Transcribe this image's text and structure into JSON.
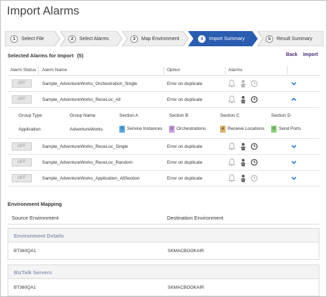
{
  "page": {
    "title": "Import Alarms"
  },
  "wizard": {
    "steps": [
      {
        "num": "1",
        "label": "Select File"
      },
      {
        "num": "2",
        "label": "Select Alarms"
      },
      {
        "num": "3",
        "label": "Map Environment"
      },
      {
        "num": "4",
        "label": "Import Summary",
        "active": true
      },
      {
        "num": "5",
        "label": "Result Summary"
      }
    ],
    "active_color": "#2a5db0"
  },
  "selected": {
    "title": "Selected Alarms for Import",
    "count": "(5)",
    "back_label": "Back",
    "import_label": "Import"
  },
  "table": {
    "headers": {
      "status": "Alarm Status",
      "name": "Alarm Name",
      "option": "Option",
      "alarms": "Alarms"
    },
    "rows": [
      {
        "toggle": "OFF",
        "name": "Sample_AdventureWorks_Orchestration_Single",
        "option": "Error on duplicate",
        "expanded": false
      },
      {
        "toggle": "OFF",
        "name": "Sample_AdventureWorks_ReceLoc_All",
        "option": "Error on duplicate",
        "expanded": true
      },
      {
        "toggle": "OFF",
        "name": "Sample_AdventureWorks_ReceLoc_Single",
        "option": "Error on duplicate",
        "expanded": false
      },
      {
        "toggle": "OFF",
        "name": "Sample_AdventureWorks_ReceLoc_Random",
        "option": "Error on duplicate",
        "expanded": false
      },
      {
        "toggle": "OFF",
        "name": "Sample_AdventureWorks_Application_AllSection",
        "option": "Error on duplicate",
        "expanded": false
      }
    ],
    "detail": {
      "headers": {
        "group_type": "Group Type",
        "group_name": "Group Name",
        "a": "Section A",
        "b": "Section B",
        "c": "Section C",
        "d": "Section D"
      },
      "values": {
        "group_type": "Application",
        "group_name": "AdventureWorks",
        "a_count": "0",
        "a_label": "Service Instances",
        "a_color": "#5aa9e6",
        "b_count": "0",
        "b_label": "Orchestrations",
        "b_color": "#c79be0",
        "c_count": "4",
        "c_label": "Receive Locations",
        "c_color": "#d9b36b",
        "d_count": "0",
        "d_label": "Send Ports",
        "d_color": "#8ccf7e"
      }
    }
  },
  "environment": {
    "title": "Environment Mapping",
    "source_header": "Source Environment",
    "dest_header": "Destination Environment",
    "panels": [
      {
        "title": "Environment Details",
        "source": "BT360QA1",
        "destination": "SKMACBOOKAIR"
      },
      {
        "title": "BizTalk Servers",
        "source": "BT360QA1",
        "destination": "SKMACBOOKAIR"
      }
    ]
  },
  "icons": [
    "bell-icon",
    "user-group-icon",
    "clock-icon",
    "chevron-down-icon",
    "chevron-up-icon"
  ]
}
